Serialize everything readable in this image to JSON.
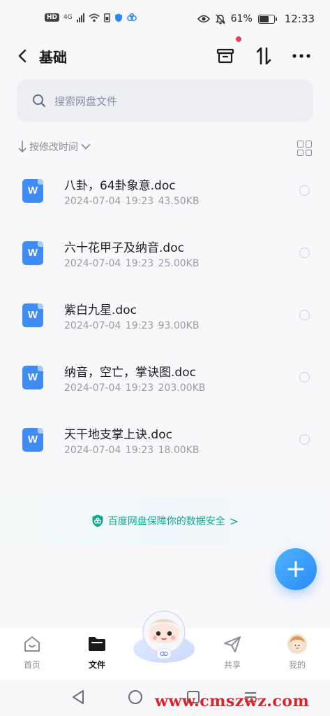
{
  "status_bar": {
    "hd": "HD",
    "network": "4G",
    "battery_pct": "61%",
    "time": "12:33"
  },
  "header": {
    "title": "基础",
    "icons": [
      "back-icon",
      "archive-icon",
      "sort-icon",
      "more-icon"
    ]
  },
  "search": {
    "placeholder": "搜索网盘文件"
  },
  "sort": {
    "label": "按修改时间"
  },
  "files": [
    {
      "name": "八卦，64卦象意.doc",
      "meta": "2024-07-04  19:23  43.50KB"
    },
    {
      "name": "六十花甲子及纳音.doc",
      "meta": "2024-07-04  19:23  25.00KB"
    },
    {
      "name": "紫白九星.doc",
      "meta": "2024-07-04  19:23  93.00KB"
    },
    {
      "name": "纳音，空亡，掌诀图.doc",
      "meta": "2024-07-04  19:23  203.00KB"
    },
    {
      "name": "天干地支掌上诀.doc",
      "meta": "2024-07-04  19:23  18.00KB"
    }
  ],
  "file_icon_letter": "W",
  "security_banner": {
    "text": "百度网盘保障你的数据安全",
    "arrow": ">"
  },
  "fab": {
    "symbol": "+"
  },
  "bottom_nav": [
    {
      "label": "首页",
      "icon": "home-icon"
    },
    {
      "label": "文件",
      "icon": "folder-icon",
      "active": true
    },
    {
      "label": "共享",
      "icon": "share-icon"
    },
    {
      "label": "我的",
      "icon": "avatar"
    }
  ],
  "watermark": "www.cmszwz.com",
  "colors": {
    "accent": "#2a8cf7",
    "security_green": "#14a88f",
    "notify_red": "#f0405a",
    "doc_blue": "#3f8cf5"
  }
}
